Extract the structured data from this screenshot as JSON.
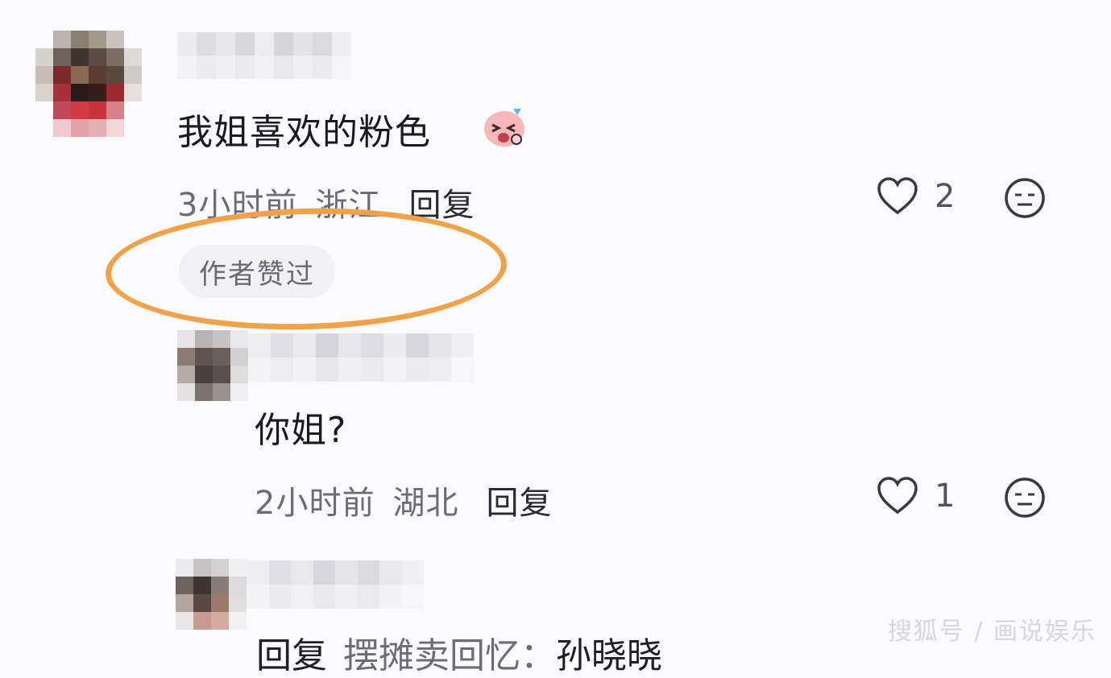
{
  "comment1": {
    "text": "我姐喜欢的粉色",
    "time": "3小时前",
    "location": "浙江",
    "reply_label": "回复",
    "likes": "2",
    "author_badge": "作者赞过"
  },
  "comment2": {
    "text": "你姐?",
    "time": "2小时前",
    "location": "湖北",
    "reply_label": "回复",
    "likes": "1"
  },
  "comment3": {
    "reply_prefix": "回复",
    "reply_target": "摆摊卖回忆：",
    "text_partial": "孙晓晓"
  },
  "watermark": "搜狐号 / 画说娱乐",
  "colors": {
    "highlight_ring": "#f0a24b",
    "badge_bg": "#f1f1f4",
    "meta_text": "#6e6a78"
  }
}
